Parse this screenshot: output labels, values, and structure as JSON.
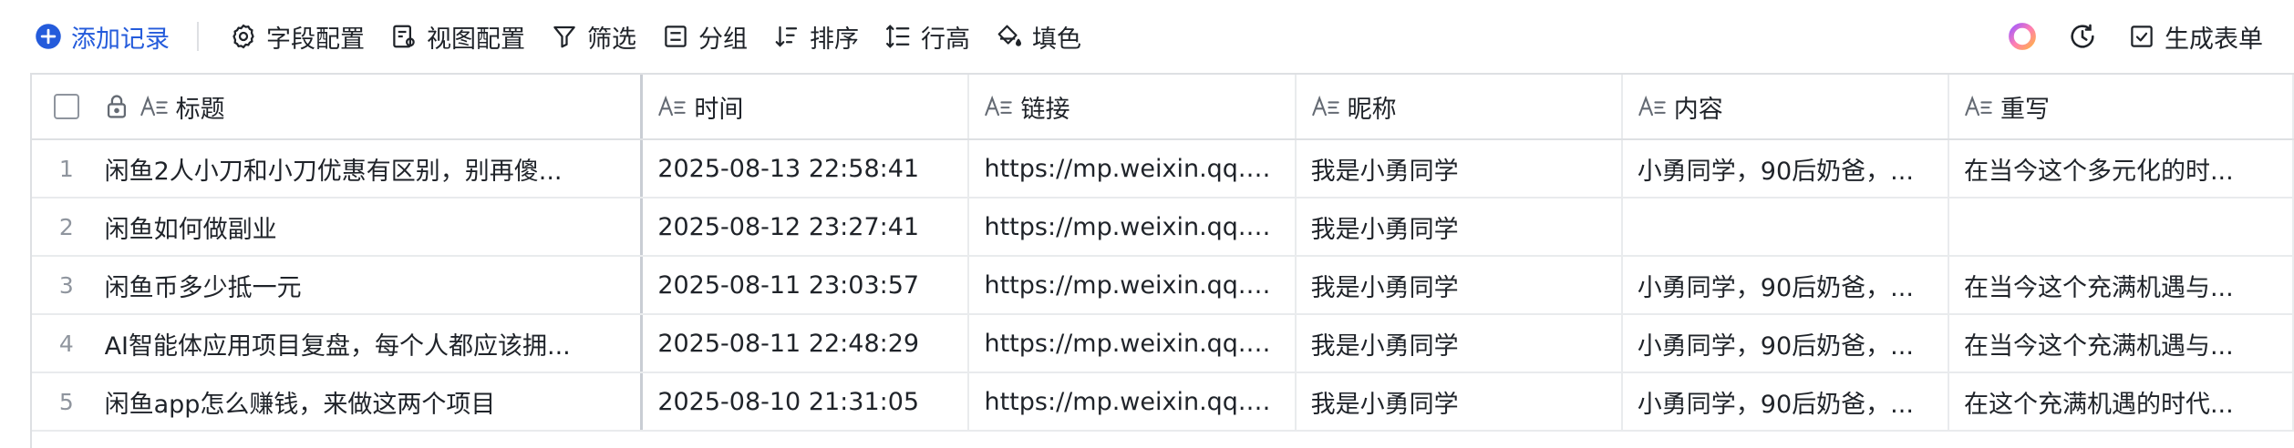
{
  "toolbar": {
    "add_record": "添加记录",
    "field_config": "字段配置",
    "view_config": "视图配置",
    "filter": "筛选",
    "group": "分组",
    "sort": "排序",
    "row_height": "行高",
    "fill_color": "填色",
    "generate_form": "生成表单"
  },
  "colors": {
    "accent": "#245bdb",
    "border": "#dee0e3",
    "text": "#1f2329",
    "muted": "#8f959e"
  },
  "table": {
    "columns": [
      "标题",
      "时间",
      "链接",
      "昵称",
      "内容",
      "重写"
    ],
    "rows": [
      {
        "index": "1",
        "title": "闲鱼2人小刀和小刀优惠有区别，别再傻...",
        "time": "2025-08-13 22:58:41",
        "link": "https://mp.weixin.qq.co...",
        "nickname": "我是小勇同学",
        "content": "小勇同学，90后奶爸，...",
        "rewrite": "在当今这个多元化的时..."
      },
      {
        "index": "2",
        "title": "闲鱼如何做副业",
        "time": "2025-08-12 23:27:41",
        "link": "https://mp.weixin.qq.co...",
        "nickname": "我是小勇同学",
        "content": "",
        "rewrite": ""
      },
      {
        "index": "3",
        "title": "闲鱼币多少抵一元",
        "time": "2025-08-11 23:03:57",
        "link": "https://mp.weixin.qq.co...",
        "nickname": "我是小勇同学",
        "content": "小勇同学，90后奶爸，...",
        "rewrite": "在当今这个充满机遇与..."
      },
      {
        "index": "4",
        "title": "AI智能体应用项目复盘，每个人都应该拥...",
        "time": "2025-08-11 22:48:29",
        "link": "https://mp.weixin.qq.co...",
        "nickname": "我是小勇同学",
        "content": "小勇同学，90后奶爸，...",
        "rewrite": "在当今这个充满机遇与..."
      },
      {
        "index": "5",
        "title": "闲鱼app怎么赚钱，来做这两个项目",
        "time": "2025-08-10 21:31:05",
        "link": "https://mp.weixin.qq.co...",
        "nickname": "我是小勇同学",
        "content": "小勇同学，90后奶爸，...",
        "rewrite": "在这个充满机遇的时代..."
      }
    ]
  }
}
